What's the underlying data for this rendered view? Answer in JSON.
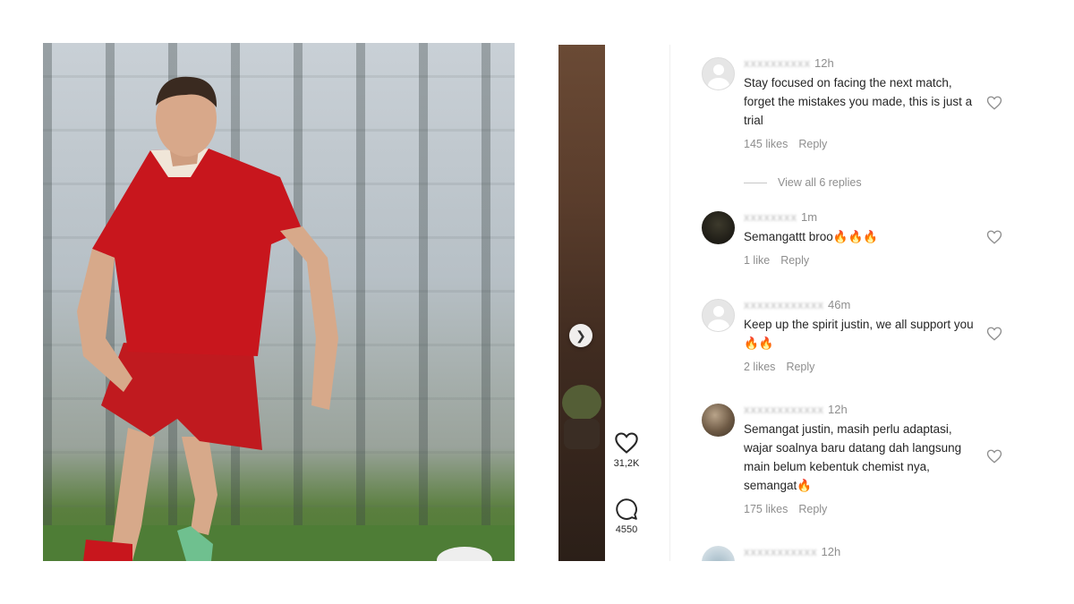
{
  "post": {
    "like_count": "31,2K",
    "comment_count": "4550"
  },
  "comments": [
    {
      "username": "xxxxxxxxxx",
      "time": "12h",
      "text": "Stay focused on facing the next match, forget the mistakes you made, this is just a trial",
      "likes": "145 likes",
      "reply": "Reply",
      "view_replies": "View all 6 replies"
    },
    {
      "username": "xxxxxxxx",
      "time": "1m",
      "text": "Semangattt broo🔥🔥🔥",
      "likes": "1 like",
      "reply": "Reply"
    },
    {
      "username": "xxxxxxxxxxxx",
      "time": "46m",
      "text": "Keep up the spirit justin, we all support you🔥🔥",
      "likes": "2 likes",
      "reply": "Reply"
    },
    {
      "username": "xxxxxxxxxxxx",
      "time": "12h",
      "text": "Semangat justin, masih perlu adaptasi, wajar soalnya baru datang dah langsung main belum kebentuk chemist nya, semangat🔥",
      "likes": "175 likes",
      "reply": "Reply"
    },
    {
      "username": "xxxxxxxxxxx",
      "time": "12h"
    }
  ],
  "icons": {
    "like": "heart-outline-icon",
    "comment": "speech-bubble-icon",
    "next": "chevron-right-icon"
  }
}
